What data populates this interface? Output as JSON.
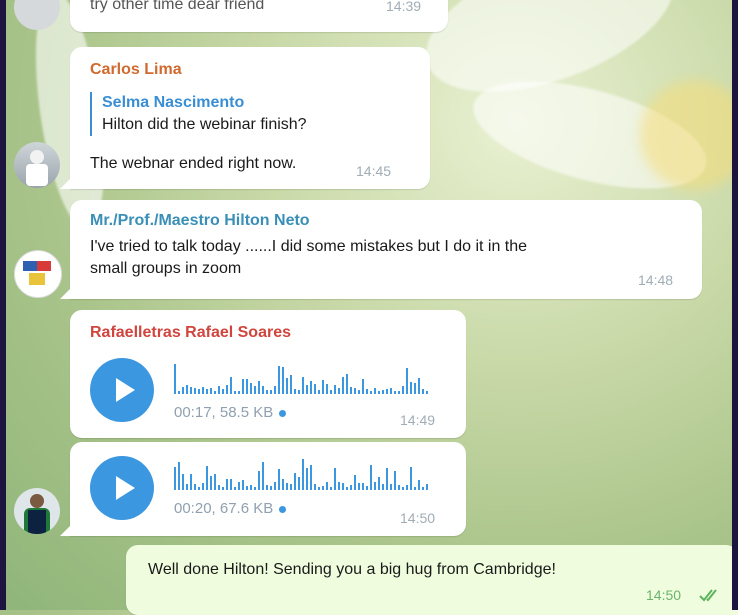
{
  "colors": {
    "sender_orange": "#d06a2f",
    "sender_teal": "#3a8fb7",
    "sender_red": "#d0453d",
    "quote_blue": "#3a8ed4",
    "play_blue": "#3a97e0",
    "outgoing_bubble": "#effdde",
    "incoming_bubble": "#ffffff"
  },
  "messages": {
    "top": {
      "text": "try other time dear friend",
      "time": "14:39"
    },
    "carlos": {
      "sender": "Carlos Lima",
      "quote_name": "Selma Nascimento",
      "quote_text": "Hilton did the webinar finish?",
      "text": "The webnar ended right now.",
      "time": "14:45"
    },
    "hilton": {
      "sender": "Mr./Prof./Maestro Hilton Neto",
      "text_line1": "I've tried to talk today ......I did some mistakes but I do it in the",
      "text_line2": "small groups in zoom",
      "time": "14:48"
    },
    "rafael_voice1": {
      "sender": "Rafaelletras Rafael Soares",
      "meta": "00:17, 58.5 KB",
      "time": "14:49"
    },
    "rafael_voice2": {
      "meta": "00:20, 67.6 KB",
      "time": "14:50"
    },
    "outgoing": {
      "text": "Well done Hilton! Sending you a big hug from Cambridge!",
      "time": "14:50"
    }
  },
  "icons": [
    "play-icon",
    "double-check-icon",
    "avatar"
  ]
}
